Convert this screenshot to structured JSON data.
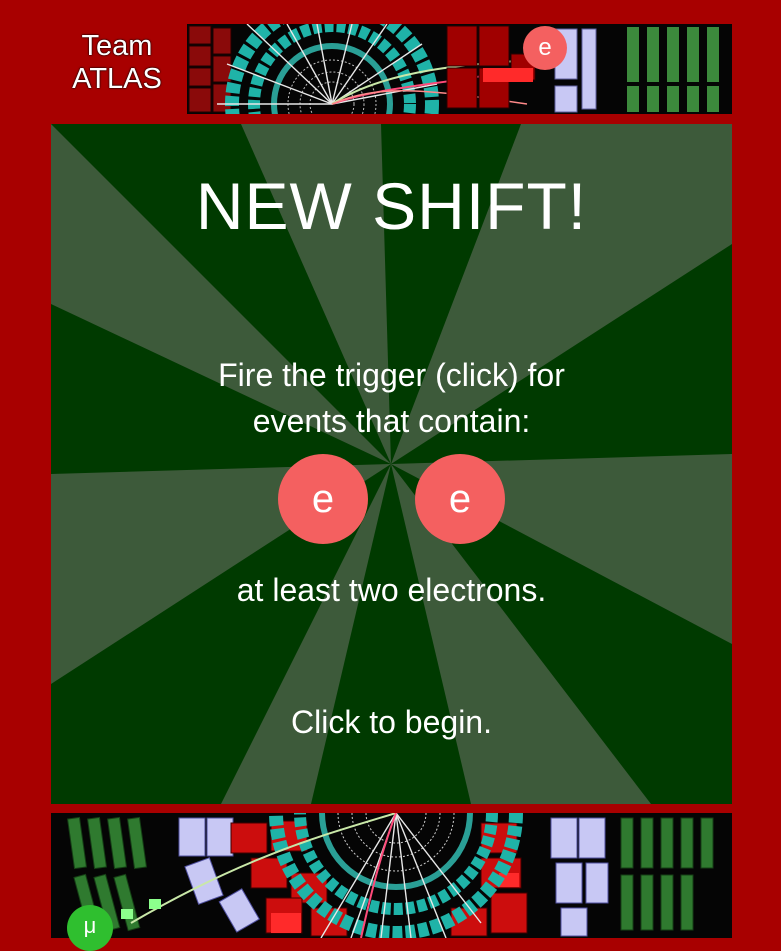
{
  "team": {
    "line1": "Team",
    "line2": "ATLAS"
  },
  "panel": {
    "title": "NEW SHIFT!",
    "instruction_line1": "Fire the trigger (click) for",
    "instruction_line2": "events that contain:",
    "particles": [
      "e",
      "e"
    ],
    "requirement": "at least two electrons.",
    "begin": "Click to begin."
  },
  "badges": {
    "top_strip": "e",
    "bottom_strip": "μ"
  },
  "colors": {
    "border": "#a80000",
    "panel_light": "#3d5a3a",
    "panel_dark": "#003a00",
    "electron": "#f46060",
    "muon": "#2fbf2f"
  }
}
